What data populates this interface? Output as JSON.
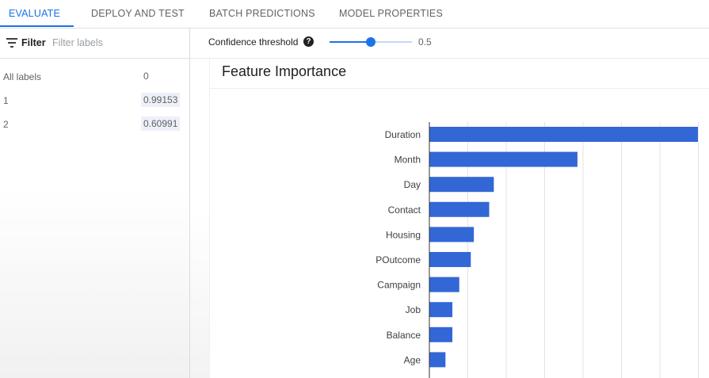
{
  "tabs": [
    {
      "label": "EVALUATE",
      "active": true
    },
    {
      "label": "DEPLOY AND TEST",
      "active": false
    },
    {
      "label": "BATCH PREDICTIONS",
      "active": false
    },
    {
      "label": "MODEL PROPERTIES",
      "active": false
    }
  ],
  "filter": {
    "label": "Filter",
    "placeholder": "Filter labels",
    "icon": "filter-list-icon"
  },
  "labels": [
    {
      "name": "All labels",
      "value": "0"
    },
    {
      "name": "1",
      "value": "0.99153"
    },
    {
      "name": "2",
      "value": "0.60991"
    }
  ],
  "confidence": {
    "label": "Confidence threshold",
    "help_icon": "help-icon",
    "value": "0.5",
    "level": 0.5
  },
  "card": {
    "title": "Feature Importance"
  },
  "colors": {
    "accent": "#1a73e8",
    "bar": "#3367d6"
  },
  "chart_data": {
    "type": "bar",
    "orientation": "horizontal",
    "categories": [
      "Duration",
      "Month",
      "Day",
      "Contact",
      "Housing",
      "POutcome",
      "Campaign",
      "Job",
      "Balance",
      "Age"
    ],
    "values": [
      0.35,
      0.193,
      0.084,
      0.078,
      0.058,
      0.054,
      0.039,
      0.03,
      0.03,
      0.021
    ],
    "xlim": [
      0,
      0.35
    ],
    "grid": true,
    "title": "",
    "xlabel": "",
    "ylabel": ""
  }
}
